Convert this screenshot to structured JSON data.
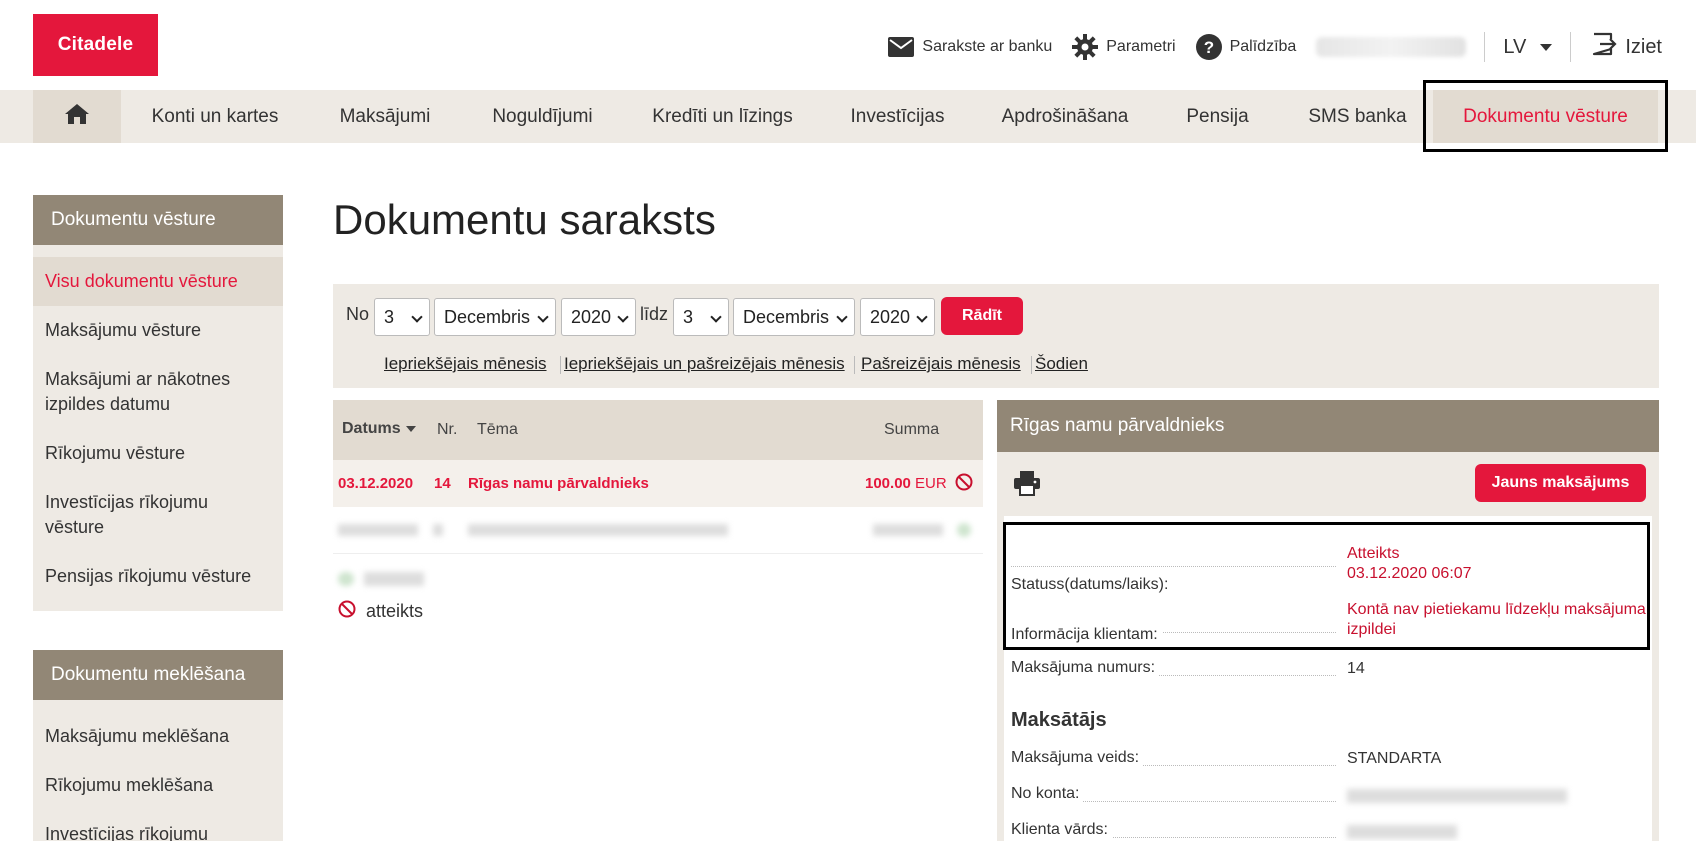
{
  "brand": {
    "logo_text": "Citadele",
    "accent": "#e4173c"
  },
  "header": {
    "links": [
      {
        "label": "Sarakste ar banku",
        "icon": "envelope-icon"
      },
      {
        "label": "Parametri",
        "icon": "gear-icon"
      },
      {
        "label": "Palīdzība",
        "icon": "help-icon"
      }
    ],
    "language": "LV",
    "logout": "Iziet"
  },
  "nav": {
    "items": [
      "Konti un kartes",
      "Maksājumi",
      "Noguldījumi",
      "Kredīti un līzings",
      "Investīcijas",
      "Apdrošināšana",
      "Pensija",
      "SMS banka",
      "Dokumentu vēsture"
    ],
    "active": "Dokumentu vēsture"
  },
  "sidebar": {
    "sections": [
      {
        "title": "Dokumentu vēsture",
        "items": [
          "Visu dokumentu vēsture",
          "Maksājumu vēsture",
          "Maksājumi ar nākotnes izpildes datumu",
          "Rīkojumu vēsture",
          "Investīcijas rīkojumu vēsture",
          "Pensijas rīkojumu vēsture"
        ]
      },
      {
        "title": "Dokumentu meklēšana",
        "items": [
          "Maksājumu meklēšana",
          "Rīkojumu meklēšana",
          "Investīcijas rīkojumu"
        ]
      }
    ]
  },
  "page": {
    "title": "Dokumentu saraksts"
  },
  "filter": {
    "from_label": "No",
    "to_label": "līdz",
    "from": {
      "day": "3",
      "month": "Decembris",
      "year": "2020"
    },
    "to": {
      "day": "3",
      "month": "Decembris",
      "year": "2020"
    },
    "show_button": "Rādīt",
    "quick_links": [
      "Iepriekšējais mēnesis",
      "Iepriekšējais un pašreizējais mēnesis",
      "Pašreizējais mēnesis",
      "Šodien"
    ]
  },
  "table": {
    "headers": {
      "date": "Datums",
      "nr": "Nr.",
      "subject": "Tēma",
      "amount": "Summa"
    },
    "rows": [
      {
        "date": "03.12.2020",
        "nr": "14",
        "subject": "Rīgas namu pārvaldnieks",
        "amount": "100.00",
        "currency": "EUR",
        "status_icon": "rejected-icon"
      }
    ]
  },
  "legend": {
    "rejected": "atteikts"
  },
  "details": {
    "title": "Rīgas namu pārvaldnieks",
    "new_payment_button": "Jauns maksājums",
    "status_label": "Statuss(datums/laiks):",
    "status_value": "Atteikts",
    "status_datetime": "03.12.2020 06:07",
    "info_label": "Informācija klientam:",
    "info_value": "Kontā nav pietiekamu līdzekļu maksājuma izpildei",
    "payment_number_label": "Maksājuma numurs:",
    "payment_number_value": "14",
    "payer_section": "Maksātājs",
    "payment_type_label": "Maksājuma veids:",
    "payment_type_value": "STANDARTA",
    "from_account_label": "No konta:",
    "client_name_label": "Klienta vārds:"
  }
}
